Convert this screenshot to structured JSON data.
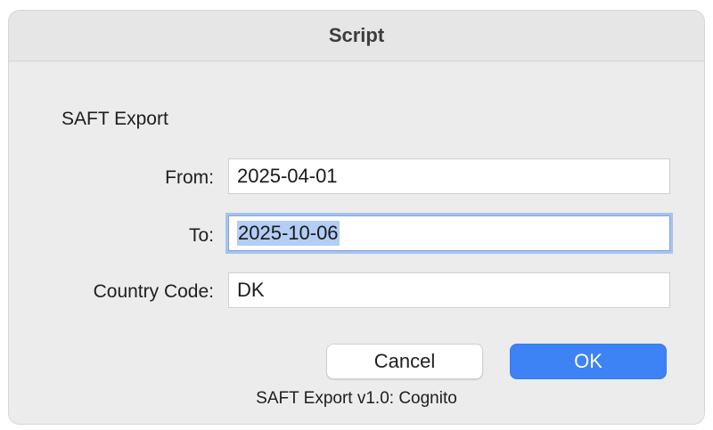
{
  "window": {
    "title": "Script"
  },
  "form": {
    "heading": "SAFT Export",
    "from_label": "From:",
    "from_value": "2025-04-01",
    "to_label": "To:",
    "to_value": "2025-10-06",
    "country_label": "Country Code:",
    "country_value": "DK"
  },
  "buttons": {
    "cancel_label": "Cancel",
    "ok_label": "OK"
  },
  "footer": {
    "text": "SAFT Export v1.0: Cognito"
  },
  "colors": {
    "accent": "#3d83f5",
    "selection": "#b3cdf5",
    "focus_ring": "#a7c2ef"
  }
}
